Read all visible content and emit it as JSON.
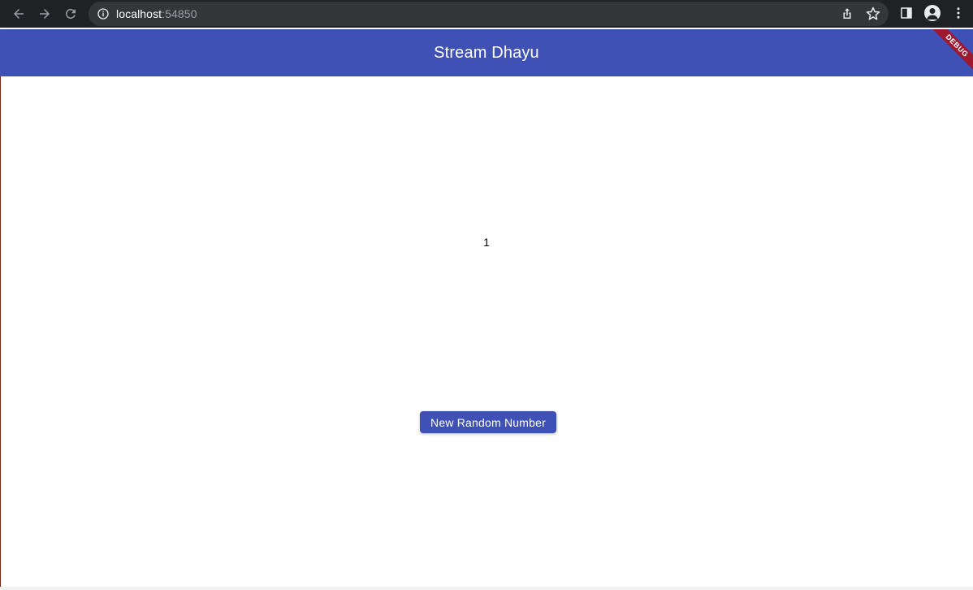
{
  "browser": {
    "url_host": "localhost",
    "url_port": ":54850"
  },
  "app": {
    "title": "Stream Dhayu",
    "debug_banner": "DEBUG",
    "accent_color": "#3f51b5",
    "banner_color": "#a0182f"
  },
  "content": {
    "number": "1",
    "button_label": "New Random Number"
  },
  "icons": {
    "back": "arrow-left-icon",
    "forward": "arrow-right-icon",
    "reload": "reload-icon",
    "info": "info-icon",
    "share": "share-icon",
    "bookmark": "star-icon",
    "side_panel": "side-panel-icon",
    "profile": "profile-icon",
    "menu": "kebab-menu-icon"
  }
}
